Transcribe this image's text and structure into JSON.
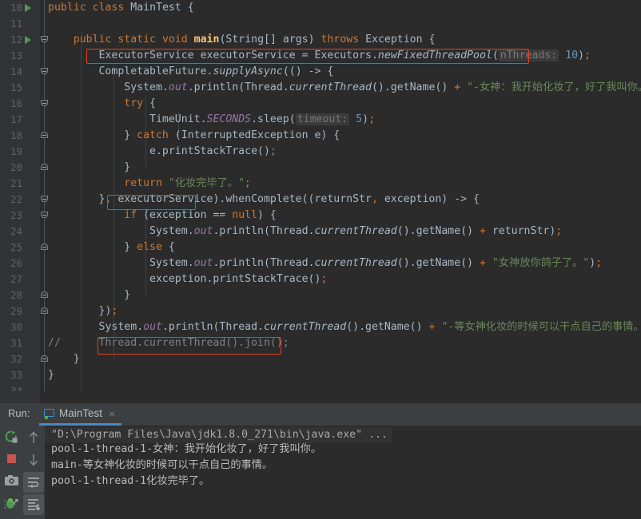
{
  "window": {
    "theme": "darcula",
    "background": "#2b2b2b",
    "gutter_background": "#313335",
    "accent": "#4a88c7",
    "highlight_box_color": "#e8401f"
  },
  "editor": {
    "first_line": 10,
    "lines": [
      {
        "no": "10",
        "run_marker": true,
        "fold": null
      },
      {
        "no": "11",
        "run_marker": false,
        "fold": null
      },
      {
        "no": "12",
        "run_marker": true,
        "fold": "open"
      },
      {
        "no": "13",
        "run_marker": false,
        "fold": null
      },
      {
        "no": "14",
        "run_marker": false,
        "fold": "open"
      },
      {
        "no": "15",
        "run_marker": false,
        "fold": null
      },
      {
        "no": "16",
        "run_marker": false,
        "fold": "open"
      },
      {
        "no": "17",
        "run_marker": false,
        "fold": null
      },
      {
        "no": "18",
        "run_marker": false,
        "fold": "close"
      },
      {
        "no": "19",
        "run_marker": false,
        "fold": null
      },
      {
        "no": "20",
        "run_marker": false,
        "fold": "close"
      },
      {
        "no": "21",
        "run_marker": false,
        "fold": null
      },
      {
        "no": "22",
        "run_marker": false,
        "fold": "open"
      },
      {
        "no": "23",
        "run_marker": false,
        "fold": "open"
      },
      {
        "no": "24",
        "run_marker": false,
        "fold": null
      },
      {
        "no": "25",
        "run_marker": false,
        "fold": "close"
      },
      {
        "no": "26",
        "run_marker": false,
        "fold": null
      },
      {
        "no": "27",
        "run_marker": false,
        "fold": null
      },
      {
        "no": "28",
        "run_marker": false,
        "fold": "close"
      },
      {
        "no": "29",
        "run_marker": false,
        "fold": "close"
      },
      {
        "no": "30",
        "run_marker": false,
        "fold": null
      },
      {
        "no": "31",
        "run_marker": false,
        "fold": null
      },
      {
        "no": "32",
        "run_marker": false,
        "fold": "close"
      },
      {
        "no": "33",
        "run_marker": false,
        "fold": null
      },
      {
        "no": "34",
        "run_marker": false,
        "fold": null
      }
    ],
    "code_text": {
      "l10": "public class MainTest {",
      "l12": "public static void main(String[] args) throws Exception {",
      "l13": "ExecutorService executorService = Executors.newFixedThreadPool( nThreads: 10);",
      "l14": "CompletableFuture.supplyAsync(() -> {",
      "l15": "System.out.println(Thread.currentThread().getName() + \"-女神：我开始化妆了，好了我叫你。\");",
      "l16": "try {",
      "l17": "TimeUnit.SECONDS.sleep( timeout: 5);",
      "l18": "} catch (InterruptedException e) {",
      "l19": "e.printStackTrace();",
      "l20": "}",
      "l21": "return \"化妆完毕了。\";",
      "l22": "}, executorService).whenComplete((returnStr, exception) -> {",
      "l23": "if (exception == null) {",
      "l24": "System.out.println(Thread.currentThread().getName() + returnStr);",
      "l25": "} else {",
      "l26": "System.out.println(Thread.currentThread().getName() + \"女神放你鸽子了。\");",
      "l27": "exception.printStackTrace();",
      "l28": "}",
      "l29": "});",
      "l30": "System.out.println(Thread.currentThread().getName() + \"-等女神化妆的时候可以干点自己的事情。\");",
      "l31": "// Thread.currentThread().join();",
      "l32": "}",
      "l33": "}"
    },
    "tokens": {
      "kw_public": "public",
      "kw_class": "class",
      "kw_static": "static",
      "kw_void": "void",
      "kw_throws": "throws",
      "kw_try": "try",
      "kw_catch": "catch",
      "kw_return": "return",
      "kw_if": "if",
      "kw_else": "else",
      "kw_null": "null",
      "type_MainTest": "MainTest",
      "type_String": "String[]",
      "id_args": "args",
      "type_Exception": "Exception",
      "type_ExecutorService": "ExecutorService",
      "id_executorService": "executorService",
      "type_Executors": "Executors",
      "m_newFixedThreadPool": "newFixedThreadPool",
      "hint_nThreads": "nThreads:",
      "num_10": "10",
      "type_CompletableFuture": "CompletableFuture",
      "m_supplyAsync": "supplyAsync",
      "type_System": "System",
      "f_out": "out",
      "m_println": "println",
      "type_Thread": "Thread",
      "m_currentThread": "currentThread",
      "m_getName": "getName",
      "type_TimeUnit": "TimeUnit",
      "f_SECONDS": "SECONDS",
      "m_sleep": "sleep",
      "hint_timeout": "timeout:",
      "num_5": "5",
      "type_InterruptedException": "InterruptedException",
      "id_e": "e",
      "m_printStackTrace": "printStackTrace",
      "m_whenComplete": "whenComplete",
      "id_returnStr": "returnStr",
      "id_exception": "exception",
      "m_main": "main",
      "m_join": "join"
    },
    "strings": {
      "s15": "\"-女神：我开始化妆了，好了我叫你。\"",
      "s21": "\"化妆完毕了。\"",
      "s26": "\"女神放你鸽子了。\"",
      "s30": "\"-等女神化妆的时候可以干点自己的事情。\""
    },
    "comment_line31": "// Thread.currentThread().join();",
    "highlight_boxes": [
      {
        "name": "line13-executor-declaration",
        "line": 13
      },
      {
        "name": "line22-executorservice-arg",
        "line": 22
      },
      {
        "name": "line31-join-comment",
        "line": 31
      }
    ]
  },
  "run_window": {
    "label": "Run:",
    "tab": {
      "name": "MainTest",
      "close": "×",
      "icon": "monitor-icon"
    },
    "toolbar": {
      "rerun": "rerun-icon",
      "stop": "stop-icon",
      "print": "camera-icon",
      "thread_dump": "thread-dump-icon",
      "up": "arrow-up-icon",
      "down": "arrow-down-icon",
      "soft_wrap": "soft-wrap-icon",
      "scroll_to_end": "scroll-to-end-icon"
    },
    "console_lines": [
      "\"D:\\Program Files\\Java\\jdk1.8.0_271\\bin\\java.exe\" ...",
      "pool-1-thread-1-女神：我开始化妆了，好了我叫你。",
      "main-等女神化妆的时候可以干点自己的事情。",
      "pool-1-thread-1化妆完毕了。"
    ]
  }
}
